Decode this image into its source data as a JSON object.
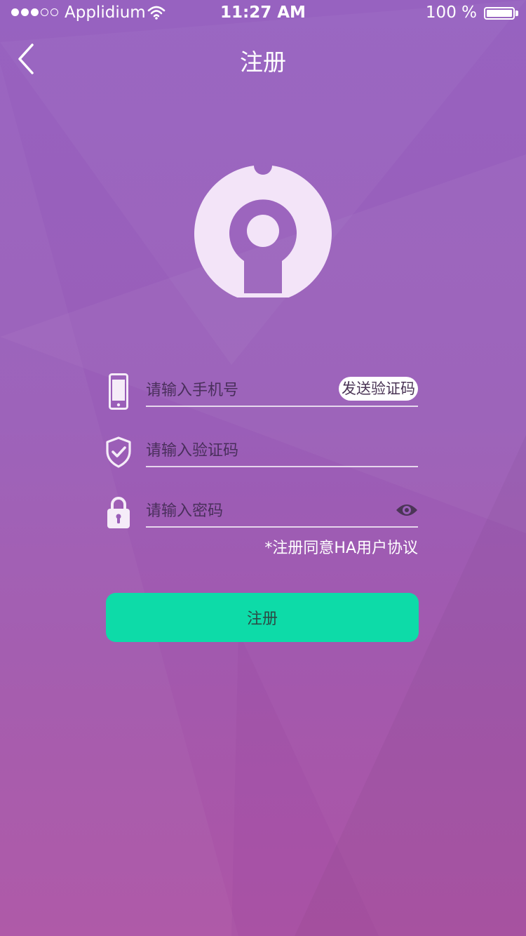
{
  "status_bar": {
    "carrier": "Applidium",
    "time": "11:27 AM",
    "battery": "100 %"
  },
  "header": {
    "title": "注册",
    "back_icon": "chevron-left-icon"
  },
  "logo": {
    "icon": "keyhole-logo-icon",
    "color": "#f3e4f8"
  },
  "form": {
    "phone": {
      "placeholder": "请输入手机号",
      "icon": "phone-icon",
      "value": ""
    },
    "send_code_label": "发送验证码",
    "code": {
      "placeholder": "请输入验证码",
      "icon": "shield-check-icon",
      "value": ""
    },
    "password": {
      "placeholder": "请输入密码",
      "icon": "lock-icon",
      "value": "",
      "toggle_icon": "eye-icon"
    },
    "agreement": "*注册同意HA用户协议",
    "submit_label": "注册"
  },
  "colors": {
    "background_top": "#9762c0",
    "background_bottom": "#ad55a6",
    "accent": "#0ddba8"
  }
}
